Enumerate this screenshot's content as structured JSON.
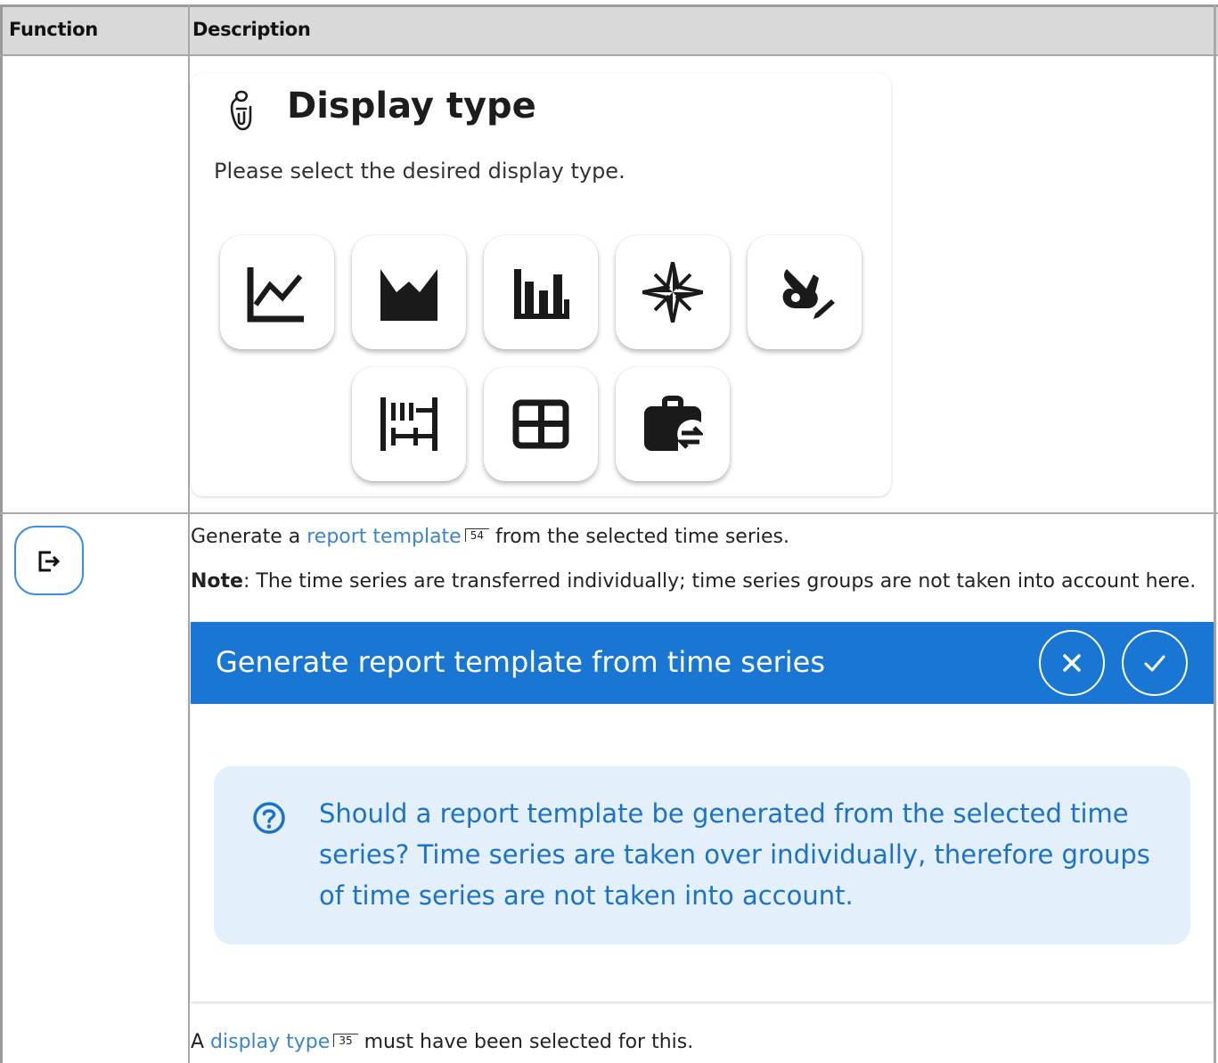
{
  "table": {
    "headers": [
      "Function",
      "Description"
    ]
  },
  "display_type_card": {
    "title": "Display type",
    "description": "Please select the desired display type.",
    "title_icon": "paper-clip-hand-icon",
    "options": [
      {
        "icon": "line-chart-icon"
      },
      {
        "icon": "area-chart-icon"
      },
      {
        "icon": "bar-chart-icon"
      },
      {
        "icon": "compass-rose-icon"
      },
      {
        "icon": "hand-pen-icon"
      },
      {
        "icon": "gantt-timeline-icon"
      },
      {
        "icon": "table-grid-icon"
      },
      {
        "icon": "briefcase-transfer-icon"
      }
    ]
  },
  "row2": {
    "function_icon": "export-icon",
    "line1_pre": "Generate a ",
    "line1_link": "report template",
    "line1_ref": "54",
    "line1_post": " from the selected time series.",
    "note_label": "Note",
    "note_text": ": The time series are transferred individually; time series groups are not taken into account here.",
    "footer_pre": "A ",
    "footer_link": "display type",
    "footer_ref": "35",
    "footer_post": " must have been selected for this."
  },
  "dialog": {
    "title": "Generate report template from time series",
    "message": "Should a report template be generated from the selected time series? Time series are taken over individually, therefore groups of time series are not taken into account.",
    "cancel_icon": "close-icon",
    "confirm_icon": "check-icon",
    "info_icon": "help-circle-icon",
    "colors": {
      "bar": "#1976d2",
      "alert_bg": "#e3f0fc",
      "alert_text": "#1c72c7"
    }
  },
  "colors": {
    "link": "#3a86c8",
    "header_bg": "#d9d9d9"
  }
}
